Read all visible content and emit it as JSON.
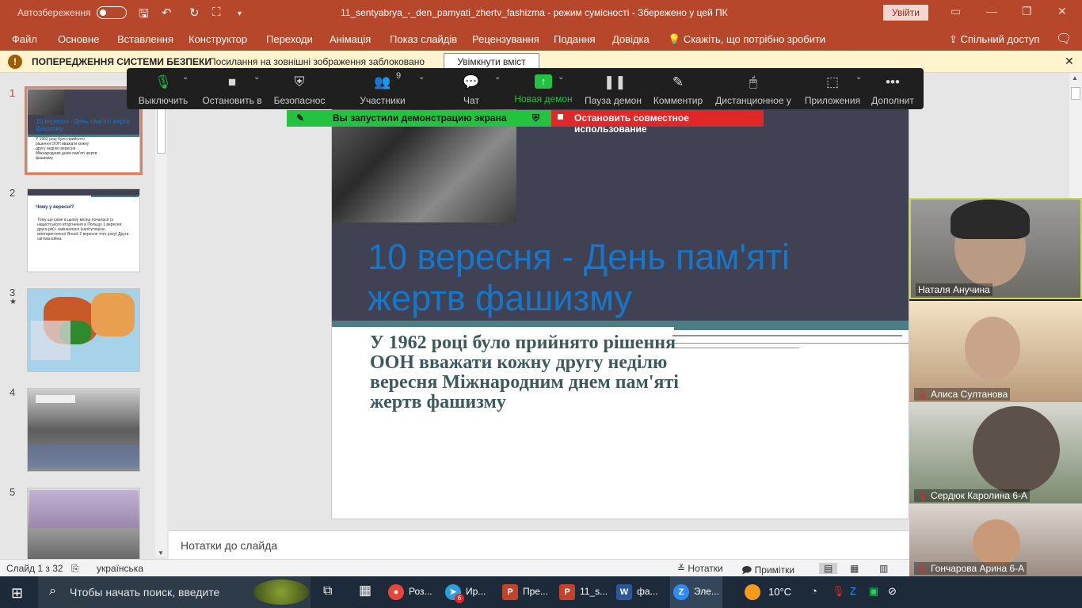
{
  "titlebar": {
    "autosave_label": "Автозбереження",
    "doc_title": "11_sentyabrya_-_den_pamyati_zhertv_fashizma  -  режим сумісності  -  Збережено у цей ПК",
    "signin": "Увійти"
  },
  "ribbon": {
    "tabs": [
      "Файл",
      "Основне",
      "Вставлення",
      "Конструктор",
      "Переходи",
      "Анімація",
      "Показ слайдів",
      "Рецензування",
      "Подання",
      "Довідка"
    ],
    "tell_me": "Скажіть, що потрібно зробити",
    "share": "Спільний доступ"
  },
  "security": {
    "title": "ПОПЕРЕДЖЕННЯ СИСТЕМИ БЕЗПЕКИ",
    "message": "Посилання на зовнішні зображення заблоковано",
    "enable_button": "Увімкнути вміст"
  },
  "thumbnails": {
    "slides": [
      {
        "num": "1",
        "title": "10 вересня - День пам'яті жертв фашизму",
        "text": "У 1962 році було прийнято рішення ООН вважати кожну другу неділю вересня Міжнародним днем пам'яті жертв фашизму"
      },
      {
        "num": "2",
        "title": "Чому у вересні?",
        "text": "Тому що саме в цьому місяці почалася (з нацистського вторгнення в Польщу 1 вересня друга рік) і закінчилася (капітуляцією мілітаристичної Японії 2 вересня того року) Друга світова війна."
      },
      {
        "num": "3",
        "title": "",
        "text": ""
      },
      {
        "num": "4",
        "title": "",
        "text": ""
      },
      {
        "num": "5",
        "title": "",
        "text": ""
      }
    ],
    "star_marker": "★"
  },
  "slide": {
    "title": "10 вересня - День пам'яті жертв фашизму",
    "body": "У 1962 році було прийнято рішення ООН вважати кожну другу неділю вересня Міжнародним днем пам'яті жертв фашизму"
  },
  "notes": {
    "placeholder": "Нотатки до слайда"
  },
  "status": {
    "slide_counter": "Слайд 1 з 32",
    "language": "українська",
    "notes": "Нотатки",
    "comments": "Примітки"
  },
  "zoom": {
    "buttons": [
      {
        "label": "Выключить",
        "icon": "microphone-icon"
      },
      {
        "label": "Остановить в",
        "icon": "video-camera-icon"
      },
      {
        "label": "Безопаснос",
        "icon": "shield-icon"
      },
      {
        "label": "Участники",
        "icon": "participants-icon",
        "count": "9"
      },
      {
        "label": "Чат",
        "icon": "chat-icon"
      },
      {
        "label": "Новая демон",
        "icon": "share-screen-icon"
      },
      {
        "label": "Пауза демон",
        "icon": "pause-icon"
      },
      {
        "label": "Комментир",
        "icon": "annotate-pen-icon"
      },
      {
        "label": "Дистанционное у",
        "icon": "remote-control-icon"
      },
      {
        "label": "Приложения",
        "icon": "apps-icon"
      },
      {
        "label": "Дополнит",
        "icon": "more-icon"
      }
    ],
    "share_banner": "Вы запустили демонстрацию экрана",
    "stop_banner": "Остановить совместное использование"
  },
  "participants": [
    {
      "name": "Наталя Анучина",
      "muted": false
    },
    {
      "name": "Алиса Султанова",
      "muted": true
    },
    {
      "name": "Сердюк Каролина 6-А",
      "muted": true
    },
    {
      "name": "Гончарова Арина 6-А",
      "muted": true
    }
  ],
  "taskbar": {
    "search_placeholder": "Чтобы начать поиск, введите",
    "apps": [
      {
        "label": "Роз...",
        "icon": "chrome-icon"
      },
      {
        "label": "Ир...",
        "icon": "telegram-icon",
        "badge": "6"
      },
      {
        "label": "Пре...",
        "icon": "powerpoint-icon"
      },
      {
        "label": "11_s...",
        "icon": "powerpoint-icon"
      },
      {
        "label": "фа...",
        "icon": "word-icon"
      },
      {
        "label": "Эле...",
        "icon": "zoom-icon"
      }
    ],
    "temperature": "10°C"
  },
  "colors": {
    "ppt_accent": "#b7472a",
    "zoom_green": "#23c240",
    "zoom_red": "#e02828",
    "slide_title": "#1677c8",
    "slide_dark": "#404254"
  }
}
